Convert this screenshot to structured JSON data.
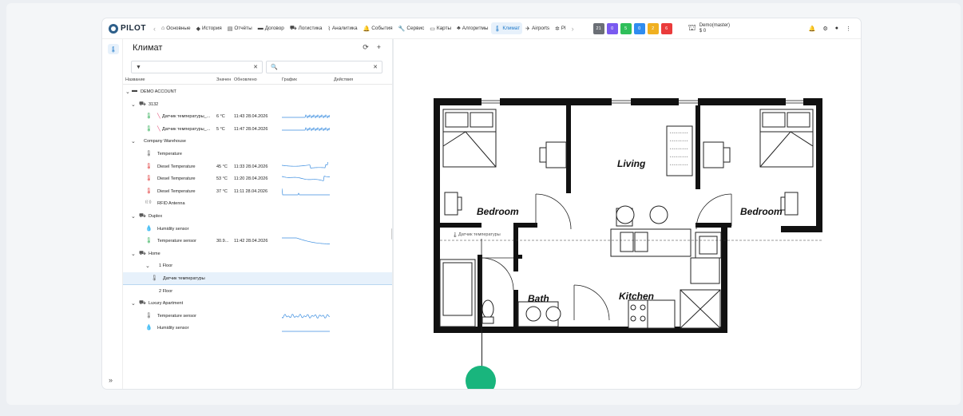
{
  "nav": {
    "items": [
      {
        "icon": "⌂",
        "label": "Основные",
        "name": "home"
      },
      {
        "icon": "◆",
        "label": "История",
        "name": "history"
      },
      {
        "icon": "▤",
        "label": "Отчёты",
        "name": "reports"
      },
      {
        "icon": "▬",
        "label": "Договор",
        "name": "contract"
      },
      {
        "icon": "⛟",
        "label": "Логистика",
        "name": "logistics"
      },
      {
        "icon": "⌇",
        "label": "Аналитика",
        "name": "analytics"
      },
      {
        "icon": "🔔",
        "label": "События",
        "name": "events"
      },
      {
        "icon": "🔧",
        "label": "Сервис",
        "name": "service"
      },
      {
        "icon": "▭",
        "label": "Карты",
        "name": "maps"
      },
      {
        "icon": "♣",
        "label": "Алгоритмы",
        "name": "algorithms"
      },
      {
        "icon": "🌡",
        "label": "Климат",
        "name": "climate",
        "active": true
      },
      {
        "icon": "✈",
        "label": "Airports",
        "name": "airports"
      },
      {
        "icon": "✲",
        "label": "Pl",
        "name": "pl"
      }
    ],
    "counts": [
      {
        "value": "21",
        "color": "#6b6f76"
      },
      {
        "value": "0",
        "color": "#7a5af0"
      },
      {
        "value": "5",
        "color": "#2fbf5a"
      },
      {
        "value": "0",
        "color": "#2f8cf0"
      },
      {
        "value": "2",
        "color": "#f0b020"
      },
      {
        "value": "6",
        "color": "#ea3b3b"
      }
    ],
    "user": {
      "name": "Demo(master)",
      "balance": "$ 0"
    }
  },
  "panel": {
    "title": "Климат",
    "search_placeholder": "",
    "columns": {
      "name": "Название",
      "value": "Значен",
      "updated": "Обновлено",
      "chart": "График",
      "actions": "Действия"
    },
    "rows": [
      {
        "level": 0,
        "kind": "group",
        "icon": "▬",
        "name": "DEMO ACCOUNT",
        "value": "",
        "time": ""
      },
      {
        "level": 1,
        "kind": "object",
        "icon": "⛟",
        "name": "3132",
        "value": "",
        "time": ""
      },
      {
        "level": 2,
        "kind": "sensor",
        "icon": "🌡",
        "warn": true,
        "name": "Датчик температуры_...",
        "value": "6 °C",
        "time": "11:43 28.04.2026",
        "spark": "noisy"
      },
      {
        "level": 2,
        "kind": "sensor",
        "icon": "🌡",
        "warn": true,
        "name": "Датчик температуры_...",
        "value": "5 °C",
        "time": "11:47 28.04.2026",
        "spark": "noisy"
      },
      {
        "level": 1,
        "kind": "object-noicon",
        "icon": "",
        "name": "Company Warehouse",
        "value": "",
        "time": ""
      },
      {
        "level": 2,
        "kind": "sensor-gray",
        "icon": "🌡",
        "name": "Temperature",
        "value": "",
        "time": ""
      },
      {
        "level": 2,
        "kind": "sensor-red",
        "icon": "🌡",
        "name": "Diesel Temperature",
        "value": "45 °C",
        "time": "11:33 28.04.2026",
        "spark": "dip"
      },
      {
        "level": 2,
        "kind": "sensor-red",
        "icon": "🌡",
        "name": "Diesel Temperature",
        "value": "53 °C",
        "time": "11:20 28.04.2026",
        "spark": "dip2"
      },
      {
        "level": 2,
        "kind": "sensor-red",
        "icon": "🌡",
        "name": "Diesel Temperature",
        "value": "37 °C",
        "time": "11:11 28.04.2026",
        "spark": "flat"
      },
      {
        "level": 2,
        "kind": "antenna",
        "icon": "((·))",
        "name": "RFID Antenna",
        "value": "",
        "time": ""
      },
      {
        "level": 1,
        "kind": "object",
        "icon": "⛟",
        "name": "Duplex",
        "value": "",
        "time": ""
      },
      {
        "level": 2,
        "kind": "humidity",
        "icon": "💧",
        "name": "Humidity sensor",
        "value": "",
        "time": ""
      },
      {
        "level": 2,
        "kind": "sensor",
        "icon": "🌡",
        "name": "Temperature sensor",
        "value": "30.9...",
        "time": "11:42 28.04.2026",
        "spark": "curve"
      },
      {
        "level": 1,
        "kind": "object",
        "icon": "⛟",
        "name": "Home",
        "value": "",
        "time": ""
      },
      {
        "level": 2,
        "kind": "folder",
        "icon": "",
        "name": "1 Floor",
        "value": "",
        "time": ""
      },
      {
        "level": 3,
        "kind": "sensor-gray",
        "icon": "🌡",
        "name": "Датчик температуры",
        "value": "",
        "time": "",
        "selected": true
      },
      {
        "level": 2,
        "kind": "folder-leaf",
        "icon": "",
        "name": "2 Floor",
        "value": "",
        "time": ""
      },
      {
        "level": 1,
        "kind": "object",
        "icon": "⛟",
        "name": "Luxury Apartment",
        "value": "",
        "time": ""
      },
      {
        "level": 2,
        "kind": "sensor-gray",
        "icon": "🌡",
        "name": "Temperature sensor",
        "value": "",
        "time": "",
        "spark": "wave"
      },
      {
        "level": 2,
        "kind": "humidity",
        "icon": "💧",
        "name": "Humidity sensor",
        "value": "",
        "time": "",
        "spark": "line"
      }
    ]
  },
  "plan": {
    "rooms": {
      "living": "Living",
      "bedroom_left": "Bedroom",
      "bedroom_right": "Bedroom",
      "bath": "Bath",
      "kitchen": "Kitchen"
    },
    "sensor_label": "Датчик температуры",
    "marker_color": "#19b57d"
  }
}
